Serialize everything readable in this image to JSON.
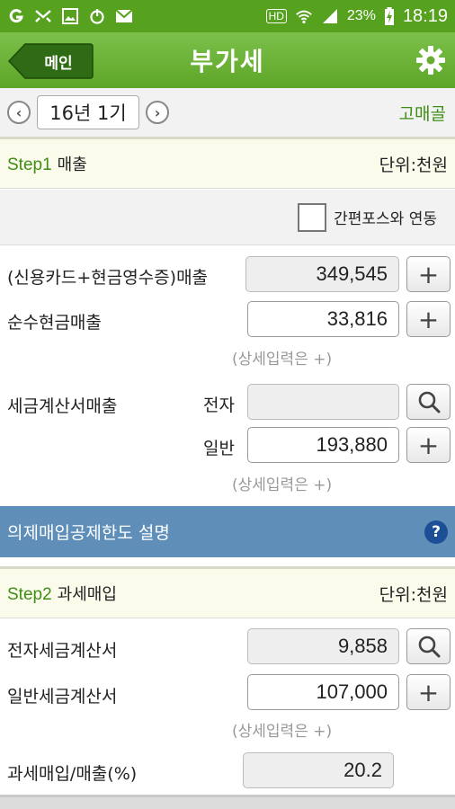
{
  "statusbar": {
    "icons": [
      "g-app-icon",
      "transfer-icon",
      "image-icon",
      "power-icon",
      "mail-icon"
    ],
    "hd_label": "HD",
    "battery": "23%",
    "time": "18:19"
  },
  "navbar": {
    "back_label": "메인",
    "title": "부가세",
    "settings_icon": "gear-icon"
  },
  "period": {
    "value": "16년 1기",
    "corner_link": "고매골"
  },
  "step1": {
    "prefix": "Step1",
    "title": "매출",
    "unit": "단위:천원",
    "pos_link_label": "간편포스와 연동",
    "card_sales_label": "(신용카드+현금영수증)매출",
    "card_sales_value": "349,545",
    "cash_sales_label": "순수현금매출",
    "cash_sales_value": "33,816",
    "detail_hint": "(상세입력은 +)",
    "invoice_label": "세금계산서매출",
    "electronic_label": "전자",
    "electronic_value": "",
    "general_label": "일반",
    "general_value": "193,880"
  },
  "banner": {
    "label": "의제매입공제한도 설명",
    "help_mark": "?"
  },
  "step2": {
    "prefix": "Step2",
    "title": "과세매입",
    "unit": "단위:천원",
    "e_invoice_label": "전자세금계산서",
    "e_invoice_value": "9,858",
    "general_invoice_label": "일반세금계산서",
    "general_invoice_value": "107,000",
    "detail_hint": "(상세입력은 +)",
    "ratio_label": "과세매입/매출(%)",
    "ratio_value": "20.2"
  },
  "buttons": {
    "plus": "+",
    "prev": "‹",
    "next": "›"
  },
  "colors": {
    "status_green": "#56a21f",
    "nav_green": "#6db33a",
    "link_green": "#3e8e13",
    "banner_blue": "#5f8fb9",
    "help_blue": "#1d4f96"
  }
}
